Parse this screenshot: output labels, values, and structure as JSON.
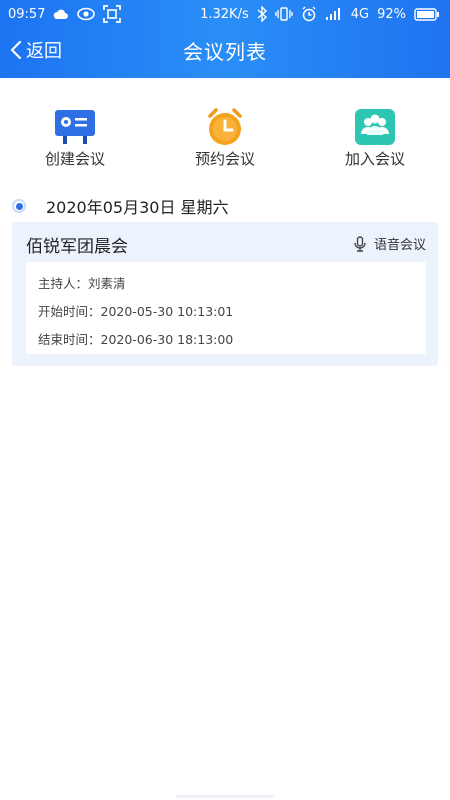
{
  "status_bar": {
    "time": "09:57",
    "network_speed": "1.32K/s",
    "network_type": "4G",
    "battery": "92%",
    "icons_left": [
      "cloud-icon",
      "eye-icon",
      "scan-icon"
    ],
    "icons_right": [
      "bluetooth-icon",
      "vibrate-icon",
      "alarm-icon",
      "signal-icon",
      "battery-icon"
    ]
  },
  "navbar": {
    "back_label": "返回",
    "title": "会议列表"
  },
  "actions": [
    {
      "label": "创建会议",
      "icon": "create-meeting-icon",
      "color": "#2f6fe4"
    },
    {
      "label": "预约会议",
      "icon": "alarm-clock-icon",
      "color": "#f7a21b"
    },
    {
      "label": "加入会议",
      "icon": "join-meeting-icon",
      "color": "#2dc6b2"
    }
  ],
  "meetings": {
    "date": "2020年05月30日 星期六",
    "items": [
      {
        "title": "佰锐军团晨会",
        "type": "语音会议",
        "host": "主持人：刘素清",
        "start": "开始时间：2020-05-30 10:13:01",
        "end": "结束时间：2020-06-30 18:13:00"
      }
    ]
  },
  "colors": {
    "header_gradient_start": "#1d74f2",
    "header_gradient_end": "#2a8ef7",
    "card_background": "#edf3fc",
    "timeline_dot": "#2b6ee8"
  }
}
